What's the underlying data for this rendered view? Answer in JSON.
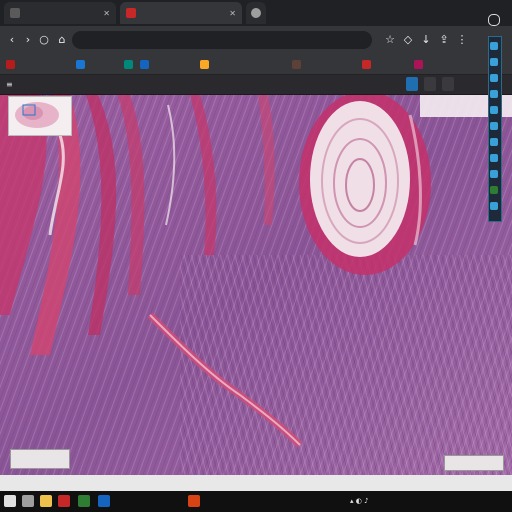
{
  "browser": {
    "tabs": [
      {
        "label": "",
        "color": "#5a5a5a",
        "active": false
      },
      {
        "label": "",
        "color": "#c62828",
        "active": true
      },
      {
        "label": "",
        "color": "#9e9e9e",
        "active": false
      }
    ],
    "address": "",
    "bookmarks": [
      {
        "label": "",
        "color": "#b71c1c"
      },
      {
        "label": "",
        "color": "#1976d2"
      },
      {
        "label": "",
        "color": "#00897b"
      },
      {
        "label": "",
        "color": "#1565c0"
      },
      {
        "label": "",
        "color": "#f9a825"
      },
      {
        "label": "",
        "color": "#5d4037"
      },
      {
        "label": "",
        "color": "#c62828"
      },
      {
        "label": "",
        "color": "#ad1457"
      }
    ]
  },
  "viewer": {
    "title": "",
    "scale_label": "",
    "zoom_label": "",
    "bottom_items": [
      "",
      "",
      "",
      ""
    ]
  },
  "colors": {
    "tissue_base": "#8e5a9a",
    "tissue_pink": "#c8346a",
    "tissue_light": "#f3e3ea",
    "accent": "#3aa0d8"
  },
  "taskbar": {
    "icons": [
      {
        "name": "start-icon",
        "color": "#e0e0e0"
      },
      {
        "name": "search-icon",
        "color": "#9e9e9e"
      },
      {
        "name": "explorer-icon",
        "color": "#f0c14b"
      },
      {
        "name": "browser-icon",
        "color": "#c62828"
      },
      {
        "name": "app-icon",
        "color": "#2e7d32"
      },
      {
        "name": "app-icon-2",
        "color": "#1565c0"
      },
      {
        "name": "app-icon-3",
        "color": "#d84315"
      }
    ],
    "clock": ""
  }
}
